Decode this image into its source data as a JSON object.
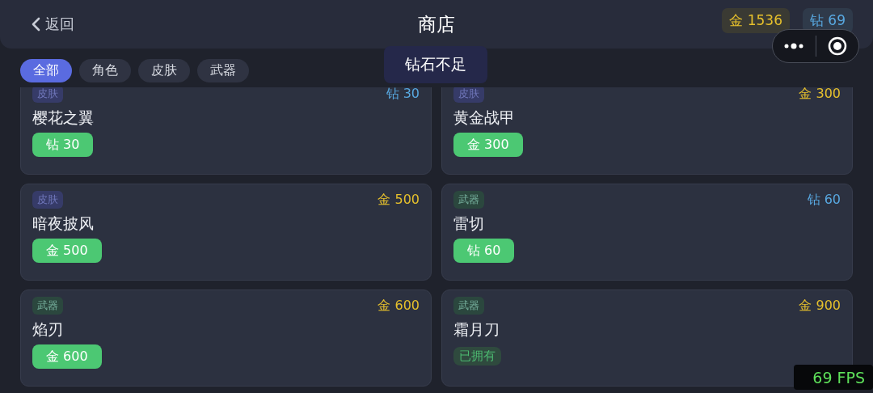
{
  "header": {
    "back": "返回",
    "title": "商店",
    "balances": [
      {
        "kind": "gold",
        "text": "金 1536"
      },
      {
        "kind": "diamond",
        "text": "钻 69"
      }
    ]
  },
  "tabs": [
    {
      "label": "全部",
      "selected": true
    },
    {
      "label": "角色",
      "selected": false
    },
    {
      "label": "皮肤",
      "selected": false
    },
    {
      "label": "武器",
      "selected": false
    }
  ],
  "toast": "钻石不足",
  "items": [
    {
      "tag": {
        "text": "皮肤",
        "color": "#363b68"
      },
      "price": {
        "text": "钻 30",
        "color": "#58a8e0"
      },
      "name": "樱花之翼",
      "action": {
        "kind": "buy",
        "text": "钻 30"
      }
    },
    {
      "tag": {
        "text": "皮肤",
        "color": "#363b68"
      },
      "price": {
        "text": "金 300",
        "color": "#e6c02c"
      },
      "name": "黄金战甲",
      "action": {
        "kind": "buy",
        "text": "金 300"
      }
    },
    {
      "tag": {
        "text": "皮肤",
        "color": "#363b68"
      },
      "price": {
        "text": "金 500",
        "color": "#e6c02c"
      },
      "name": "暗夜披风",
      "action": {
        "kind": "buy",
        "text": "金 500"
      }
    },
    {
      "tag": {
        "text": "武器",
        "color": "#2b473e"
      },
      "price": {
        "text": "钻 60",
        "color": "#58a8e0"
      },
      "name": "雷切",
      "action": {
        "kind": "buy",
        "text": "钻 60"
      }
    },
    {
      "tag": {
        "text": "武器",
        "color": "#2b473e"
      },
      "price": {
        "text": "金 600",
        "color": "#e6c02c"
      },
      "name": "焰刃",
      "action": {
        "kind": "buy",
        "text": "金 600"
      }
    },
    {
      "tag": {
        "text": "武器",
        "color": "#2b473e"
      },
      "price": {
        "text": "金 900",
        "color": "#e6c02c"
      },
      "name": "霜月刀",
      "action": {
        "kind": "owned",
        "text": "已拥有"
      }
    }
  ],
  "fps": "69 FPS"
}
